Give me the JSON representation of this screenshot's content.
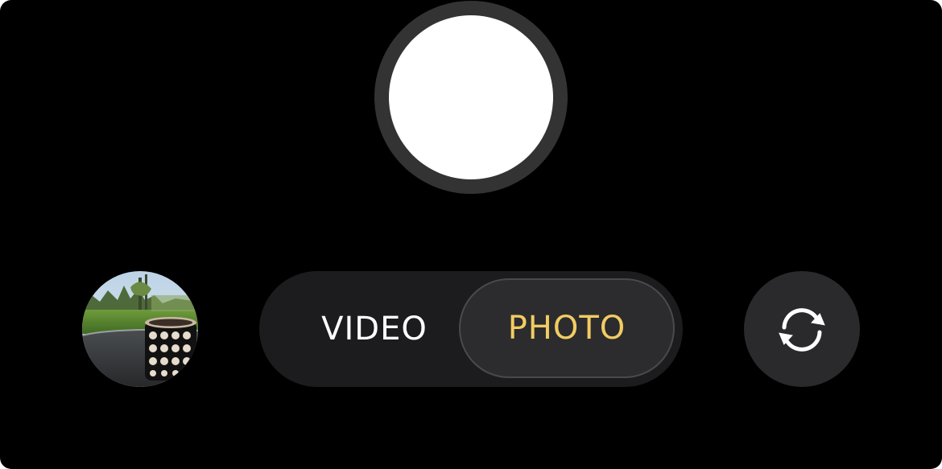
{
  "camera": {
    "shutter": {
      "icon": "shutter-circle"
    },
    "last_photo_thumbnail": {
      "icon": "photo-thumbnail"
    },
    "modes": [
      {
        "label": "VIDEO",
        "selected": false
      },
      {
        "label": "PHOTO",
        "selected": true
      }
    ],
    "flip_camera": {
      "icon": "camera-flip-icon"
    }
  },
  "colors": {
    "background": "#000000",
    "shutter_ring": "#333333",
    "shutter_core": "#ffffff",
    "pill_background": "#1c1c1e",
    "active_mode_text": "#f2cc63",
    "inactive_mode_text": "#ffffff",
    "flip_button_background": "#2a2a2c"
  }
}
